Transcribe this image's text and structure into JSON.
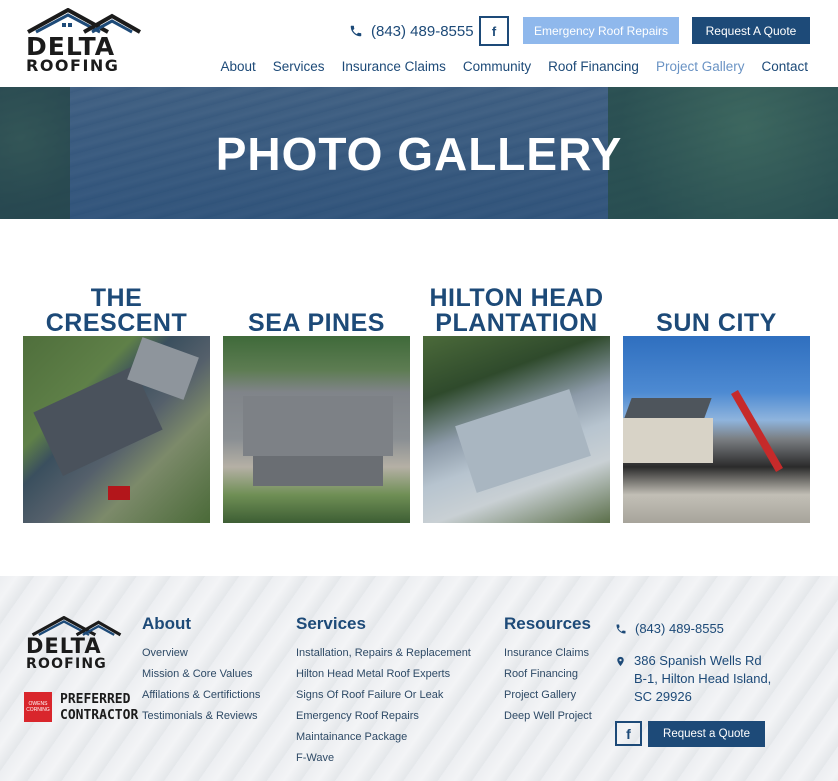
{
  "brand": {
    "logo_line1": "DELTA",
    "logo_line2": "ROOFING"
  },
  "header": {
    "phone": "(843) 489-8555",
    "facebook_glyph": "f",
    "emergency_button": "Emergency Roof Repairs",
    "quote_button": "Request A Quote",
    "nav": [
      {
        "label": "About",
        "active": false
      },
      {
        "label": "Services",
        "active": false
      },
      {
        "label": "Insurance Claims",
        "active": false
      },
      {
        "label": "Community",
        "active": false
      },
      {
        "label": "Roof Financing",
        "active": false
      },
      {
        "label": "Project Gallery",
        "active": true
      },
      {
        "label": "Contact",
        "active": false
      }
    ]
  },
  "hero": {
    "title": "PHOTO GALLERY"
  },
  "gallery": [
    {
      "title": "THE CRESCENT"
    },
    {
      "title": "SEA PINES"
    },
    {
      "title": "HILTON HEAD PLANTATION"
    },
    {
      "title": "SUN CITY"
    }
  ],
  "footer": {
    "badge_text": "OWENS CORNING",
    "preferred_line1": "PREFERRED",
    "preferred_line2": "CONTRACTOR",
    "about": {
      "heading": "About",
      "items": [
        "Overview",
        "Mission & Core Values",
        "Affilations & Certifictions",
        "Testimonials & Reviews"
      ]
    },
    "services": {
      "heading": "Services",
      "items": [
        "Installation, Repairs & Replacement",
        "Hilton Head Metal Roof Experts",
        "Signs Of Roof Failure Or Leak",
        "Emergency Roof Repairs",
        "Maintainance Package",
        "F-Wave"
      ]
    },
    "resources": {
      "heading": "Resources",
      "items": [
        "Insurance Claims",
        "Roof Financing",
        "Project Gallery",
        "Deep Well Project"
      ]
    },
    "contact": {
      "phone": "(843) 489-8555",
      "address_line1": "386 Spanish Wells Rd",
      "address_line2": "B-1, Hilton Head Island,",
      "address_line3": "SC 29926"
    },
    "facebook_glyph": "f",
    "quote_button": "Request a Quote"
  },
  "colors": {
    "primary": "#1d4a78",
    "accent_light": "#8fb8ec",
    "nav_active": "#6a93c4"
  }
}
